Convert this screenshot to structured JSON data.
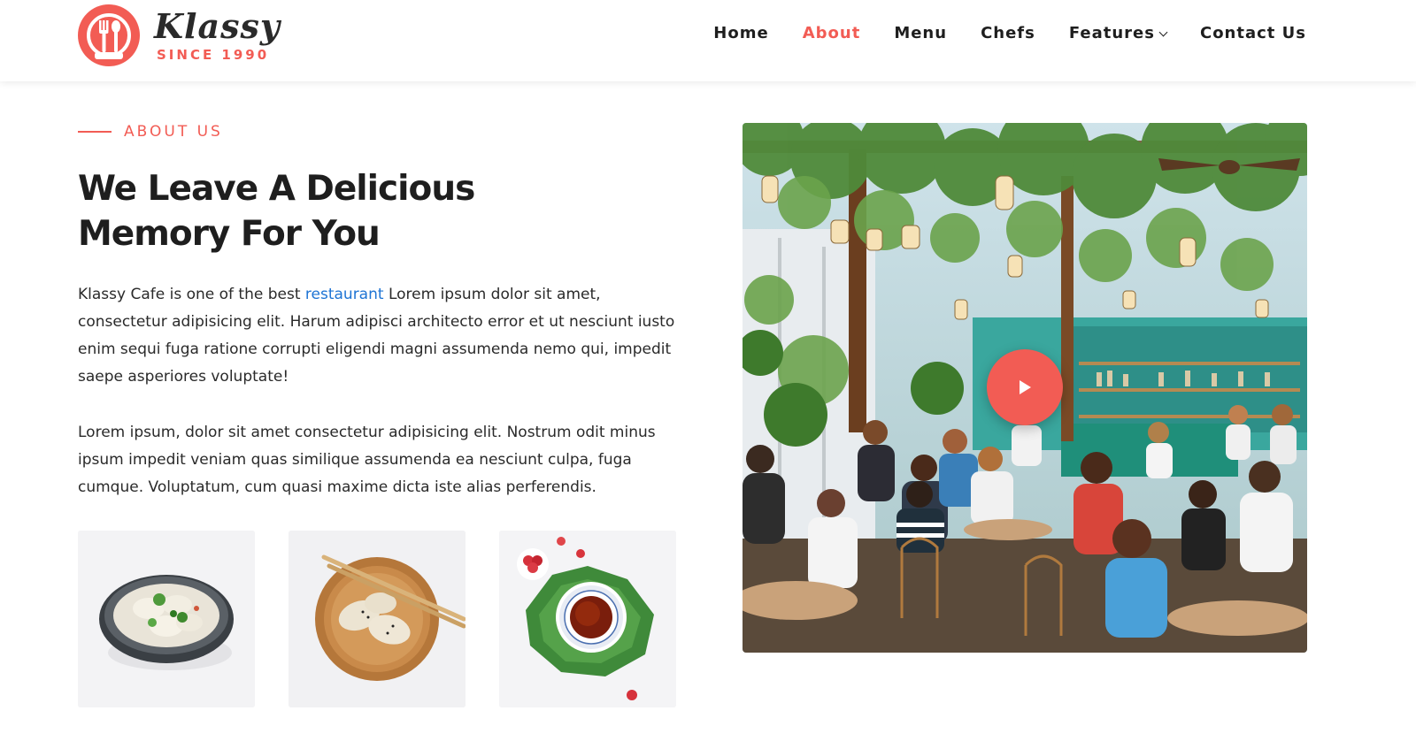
{
  "brand": {
    "name": "Klassy",
    "tagline": "SINCE 1990",
    "accent": "#f25c54",
    "icon": "fork-spoon-plate-icon"
  },
  "nav": {
    "items": [
      {
        "label": "Home",
        "active": false
      },
      {
        "label": "About",
        "active": true
      },
      {
        "label": "Menu",
        "active": false
      },
      {
        "label": "Chefs",
        "active": false
      },
      {
        "label": "Features",
        "active": false,
        "has_dropdown": true
      },
      {
        "label": "Contact Us",
        "active": false
      }
    ]
  },
  "about": {
    "section_tag": "ABOUT US",
    "heading_line1": "We Leave A Delicious",
    "heading_line2": "Memory For You",
    "para1_before": "Klassy Cafe is one of the best ",
    "para1_link": "restaurant",
    "para1_after": " Lorem ipsum dolor sit amet, consectetur adipisicing elit. Harum adipisci architecto error et ut nesciunt iusto enim sequi fuga ratione corrupti eligendi magni assumenda nemo qui, impedit saepe asperiores voluptate!",
    "para2": "Lorem ipsum, dolor sit amet consectetur adipisicing elit. Nostrum odit minus ipsum impedit veniam quas similique assumenda ea nesciunt culpa, fuga cumque. Voluptatum, cum quasi maxime dicta iste alias perferendis.",
    "link_color": "#1e74d4"
  },
  "thumbnails": [
    {
      "name": "dumplings-bowl"
    },
    {
      "name": "dumplings-wooden-plate"
    },
    {
      "name": "tea-cup-raspberries"
    }
  ],
  "video": {
    "play_icon": "play-icon"
  }
}
